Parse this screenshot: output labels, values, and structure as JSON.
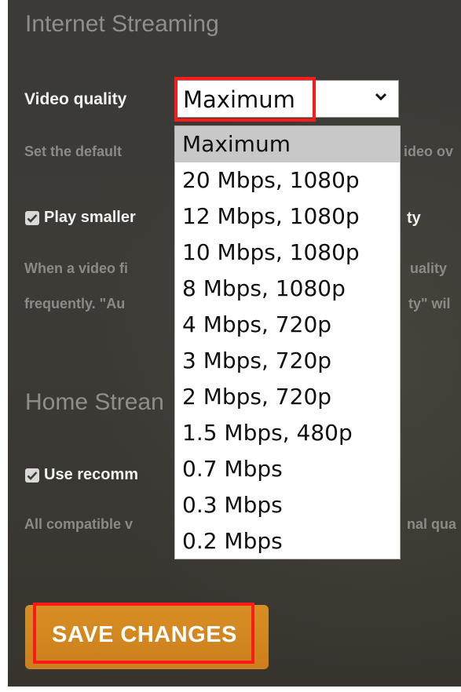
{
  "internet_streaming": {
    "heading": "Internet Streaming",
    "video_quality_label": "Video quality",
    "video_quality_value": "Maximum",
    "video_quality_help": "Set the default",
    "video_quality_help_tail": "ideo ov",
    "play_smaller_label": "Play smaller",
    "play_smaller_label_tail": "ty",
    "play_smaller_checked": true,
    "description_line1_start": "When a video fi",
    "description_line1_end": "uality",
    "description_line2_start": "frequently. \"Au",
    "description_line2_end": "ty\" wil"
  },
  "quality_options": [
    {
      "label": "Maximum",
      "selected": true
    },
    {
      "label": "20 Mbps, 1080p",
      "selected": false
    },
    {
      "label": "12 Mbps, 1080p",
      "selected": false
    },
    {
      "label": "10 Mbps, 1080p",
      "selected": false
    },
    {
      "label": "8 Mbps, 1080p",
      "selected": false
    },
    {
      "label": "4 Mbps, 720p",
      "selected": false
    },
    {
      "label": "3 Mbps, 720p",
      "selected": false
    },
    {
      "label": "2 Mbps, 720p",
      "selected": false
    },
    {
      "label": "1.5 Mbps, 480p",
      "selected": false
    },
    {
      "label": "0.7 Mbps",
      "selected": false
    },
    {
      "label": "0.3 Mbps",
      "selected": false
    },
    {
      "label": "0.2 Mbps",
      "selected": false
    }
  ],
  "home_streaming": {
    "heading": "Home Strean",
    "use_recommended_label": "Use recomm",
    "use_recommended_checked": true,
    "description_start": "All compatible v",
    "description_end": "nal qua"
  },
  "save_button": {
    "label": "SAVE CHANGES"
  },
  "colors": {
    "accent": "#d88e24",
    "highlight": "#ff1a1a",
    "panel_bg": "#3b3a36"
  }
}
